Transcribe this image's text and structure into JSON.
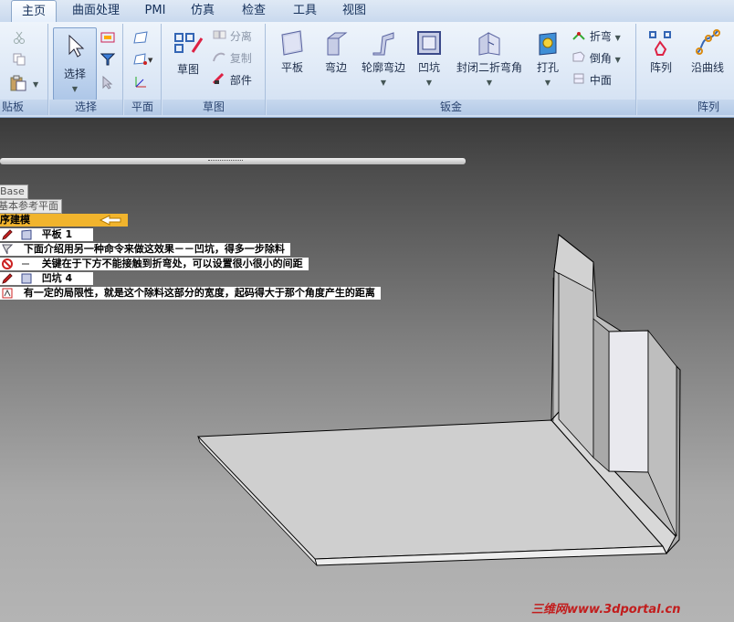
{
  "tabs": [
    "主页",
    "曲面处理",
    "PMI",
    "仿真",
    "检查",
    "工具",
    "视图"
  ],
  "active_tab": "主页",
  "groups": {
    "clipboard": {
      "label": "贴板"
    },
    "select": {
      "label": "选择",
      "button": "选择"
    },
    "plane": {
      "label": "平面"
    },
    "sketch": {
      "label": "草图",
      "button": "草图",
      "separate": "分离",
      "copy": "复制",
      "part": "部件"
    },
    "sheetmetal": {
      "label": "钣金",
      "buttons": [
        "平板",
        "弯边",
        "轮廓弯边",
        "凹坑",
        "封闭二折弯角",
        "打孔"
      ],
      "small": [
        "折弯",
        "倒角",
        "中面"
      ]
    },
    "pattern": {
      "label": "阵列",
      "buttons": [
        "阵列",
        "沿曲线"
      ]
    }
  },
  "tree": {
    "base": "Base",
    "ref_planes": "基本参考平面",
    "ordered": "序建模",
    "item1": "平板 1",
    "note1": "下面介绍用另一种命令来做这效果－－凹坑，得多一步除料",
    "note2": "关键在于下方不能接触到折弯处，可以设置很小很小的间距",
    "item2": "凹坑 4",
    "note3": "有一定的局限性，就是这个除料这部分的宽度，起码得大于那个角度产生的距离"
  },
  "watermark": "三维网www.3dportal.cn",
  "colors": {
    "ribbon": "#dde8f6",
    "highlight": "#f1b42d",
    "watermark": "#c21d1d"
  }
}
